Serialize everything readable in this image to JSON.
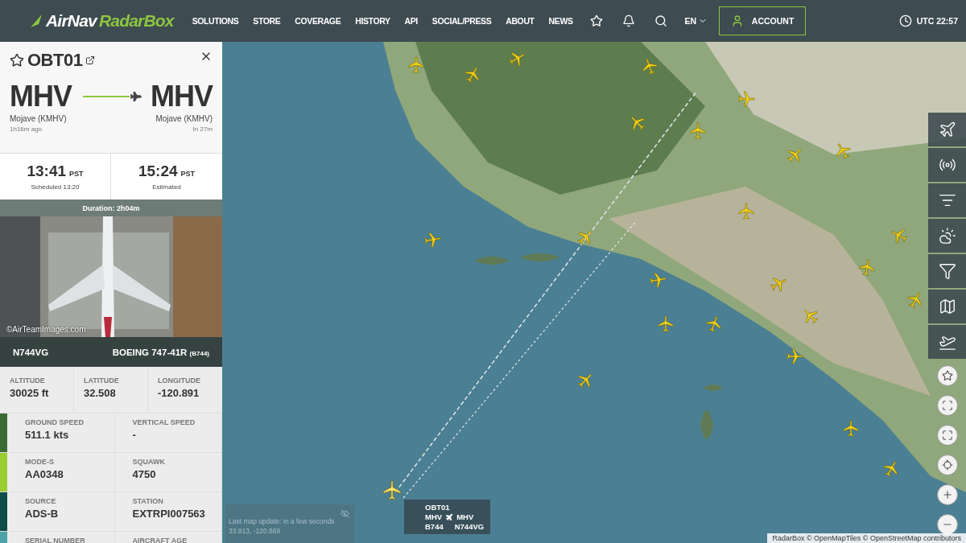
{
  "header": {
    "brand": "AirNav",
    "product": "RadarBox",
    "nav": [
      "SOLUTIONS",
      "STORE",
      "COVERAGE",
      "HISTORY",
      "API",
      "SOCIAL/PRESS",
      "ABOUT",
      "NEWS"
    ],
    "language": "EN",
    "account": "ACCOUNT",
    "clock": "UTC 22:57"
  },
  "flight": {
    "callsign": "OBT01",
    "favorite": false,
    "origin": {
      "code": "MHV",
      "name": "Mojave (KMHV)",
      "note": "1h16m ago"
    },
    "destination": {
      "code": "MHV",
      "name": "Mojave (KMHV)",
      "note": "In 27m"
    },
    "departure": {
      "time": "13:41",
      "zone": "PST",
      "caption": "Scheduled 13:20"
    },
    "arrival": {
      "time": "15:24",
      "zone": "PST",
      "caption": "Estimated"
    },
    "duration": "Duration: 2h04m",
    "photo": {
      "kind": "picture",
      "credit": "©AirTeamImages.com"
    },
    "registration": "N744VG",
    "aircraft": "BOEING 747-41R",
    "aircraft_code": "(B744)",
    "position": [
      {
        "label": "ALTITUDE",
        "value": "30025 ft"
      },
      {
        "label": "LATITUDE",
        "value": "32.508"
      },
      {
        "label": "LONGITUDE",
        "value": "-120.891"
      }
    ],
    "details": [
      {
        "color": "#3b6b35",
        "cells": [
          {
            "label": "GROUND SPEED",
            "value": "511.1 kts"
          },
          {
            "label": "VERTICAL SPEED",
            "value": "-"
          }
        ]
      },
      {
        "color": "#9acd32",
        "cells": [
          {
            "label": "MODE-S",
            "value": "AA0348"
          },
          {
            "label": "SQUAWK",
            "value": "4750"
          }
        ]
      },
      {
        "color": "#0e4d48",
        "cells": [
          {
            "label": "SOURCE",
            "value": "ADS-B"
          },
          {
            "label": "STATION",
            "value": "EXTRPI007563"
          }
        ]
      },
      {
        "color": "#4aa3a6",
        "cells": [
          {
            "label": "SERIAL NUMBER"
          },
          {
            "label": "AIRCRAFT AGE"
          }
        ]
      }
    ]
  },
  "map": {
    "toolbar": [
      {
        "kind": "flights"
      },
      {
        "kind": "radio"
      },
      {
        "kind": "filters"
      },
      {
        "kind": "weather"
      },
      {
        "kind": "funnel"
      },
      {
        "kind": "layers"
      },
      {
        "kind": "tracking"
      }
    ],
    "controls": [
      {
        "kind": "favorite"
      },
      {
        "kind": "fit"
      },
      {
        "kind": "fullscreen"
      },
      {
        "kind": "locate"
      },
      {
        "kind": "zoom-in"
      },
      {
        "kind": "zoom-out"
      }
    ],
    "flight_tag": {
      "callsign": "OBT01",
      "from": "MHV",
      "to": "MHV",
      "type": "B744",
      "registration": "N744VG"
    },
    "update": {
      "text": "Last map update: in a few seconds",
      "coords": "33.913, -120.869"
    },
    "attribution": "RadarBox © OpenMapTiles © OpenStreetMap contributors"
  }
}
